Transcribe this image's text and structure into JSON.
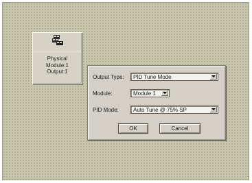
{
  "module_block": {
    "icon": "modules-icon",
    "name": "Physical",
    "module": "Module:1",
    "output": "Output:1"
  },
  "dialog": {
    "output_type": {
      "label": "Output Type:",
      "value": "PID Tune Mode"
    },
    "module": {
      "label": "Module:",
      "value": "Module 1"
    },
    "pid_mode": {
      "label": "PID Mode:",
      "value": "Auto Tune @ 75% SP"
    },
    "ok_label": "OK",
    "cancel_label": "Cancel"
  }
}
